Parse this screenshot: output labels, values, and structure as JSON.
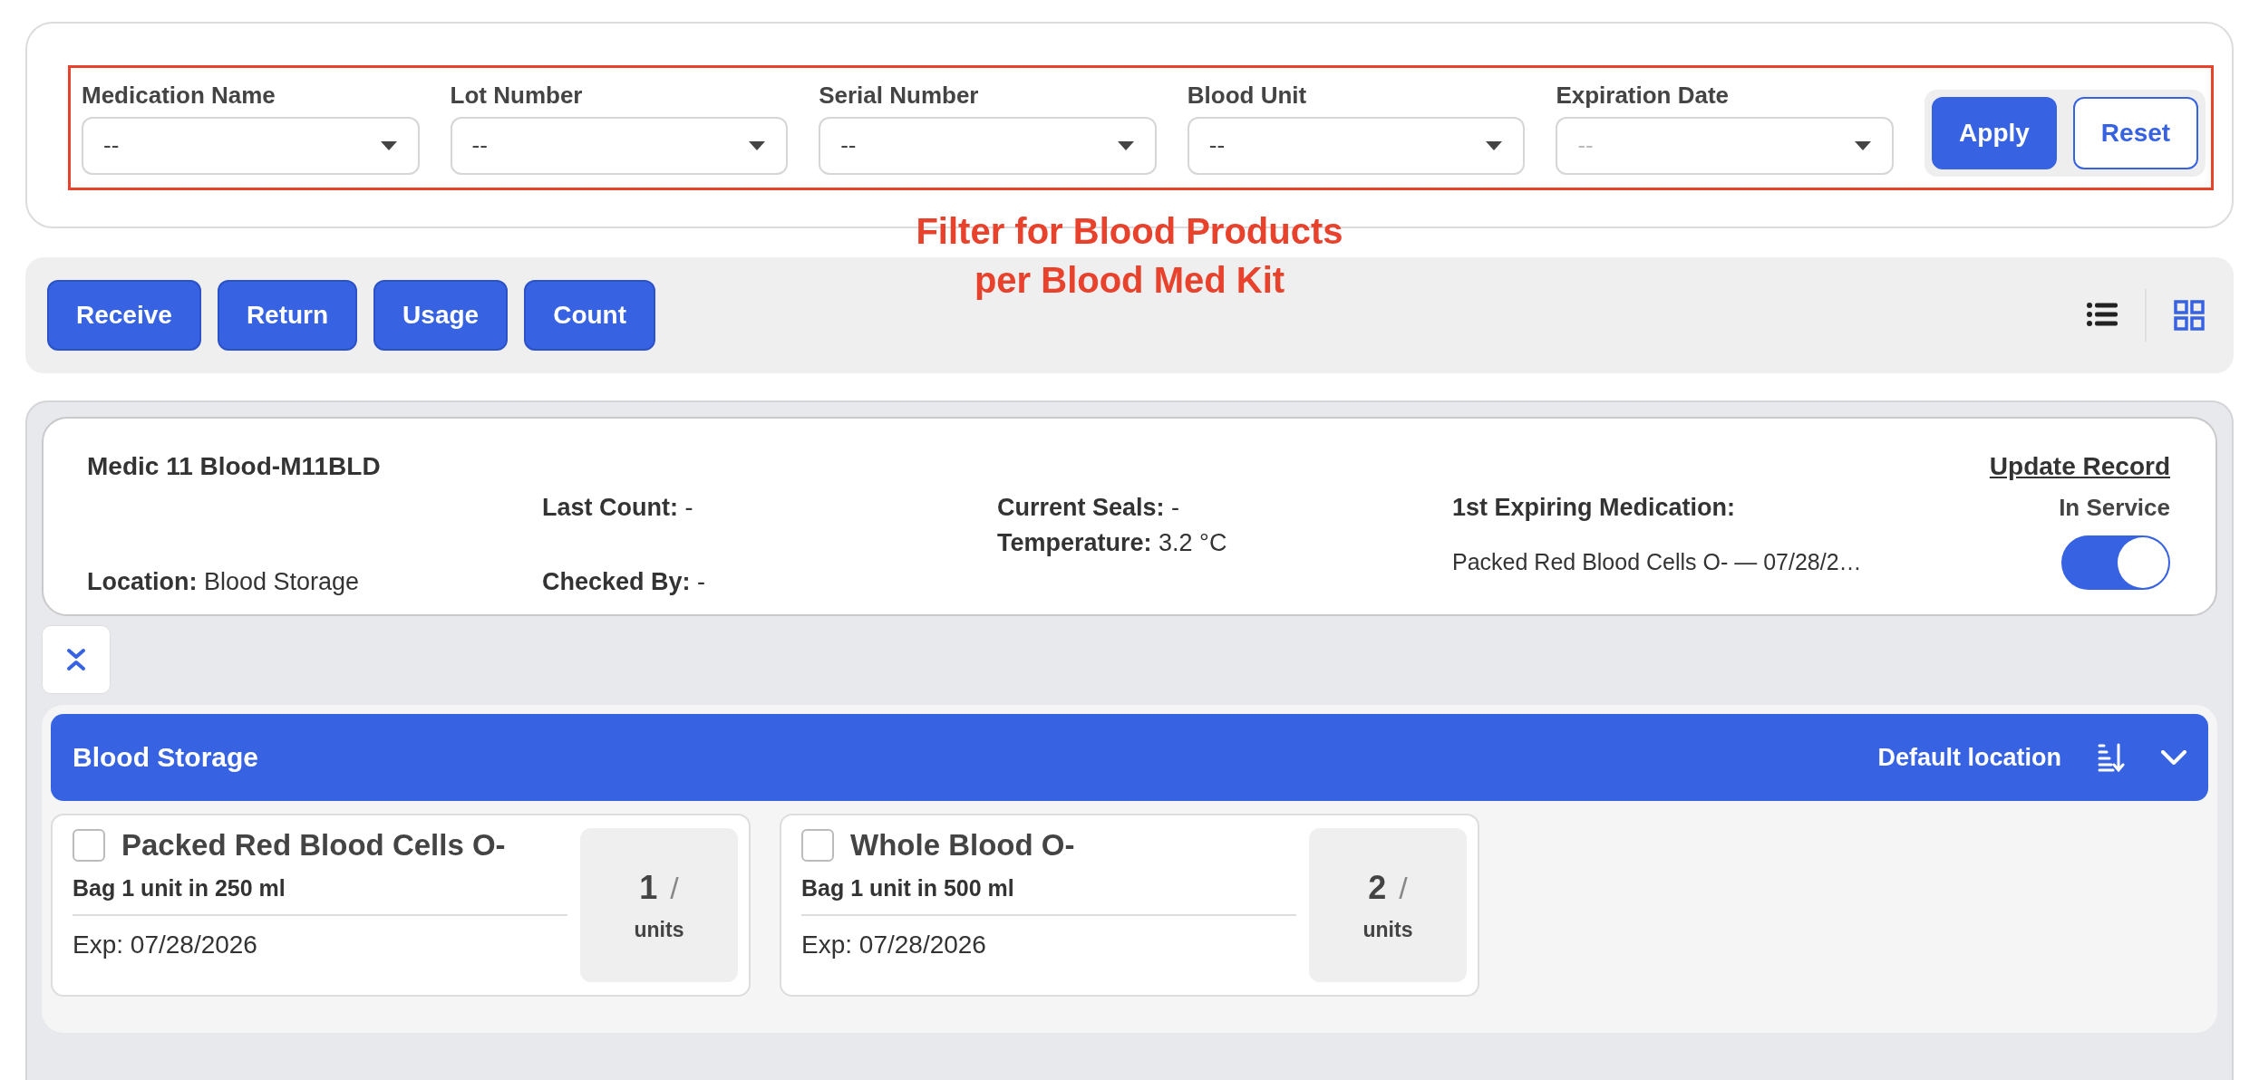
{
  "filters": {
    "fields": [
      {
        "label": "Medication Name",
        "value": "--"
      },
      {
        "label": "Lot Number",
        "value": "--"
      },
      {
        "label": "Serial Number",
        "value": "--"
      },
      {
        "label": "Blood Unit",
        "value": "--"
      },
      {
        "label": "Expiration Date",
        "placeholder": "--"
      }
    ],
    "buttons": [
      {
        "label": "Apply",
        "kind": "primary"
      },
      {
        "label": "Reset",
        "kind": "outline"
      }
    ]
  },
  "annotation": {
    "lines": [
      "Filter for Blood Products",
      "per Blood Med Kit"
    ]
  },
  "toolbar": {
    "actions": [
      "Receive",
      "Return",
      "Usage",
      "Count"
    ],
    "views": [
      {
        "kind": "list",
        "selected": false
      },
      {
        "kind": "grid",
        "selected": true
      }
    ]
  },
  "kit": {
    "title": "Medic 11 Blood-M11BLD",
    "update_link": "Update Record",
    "location": {
      "label": "Location:",
      "value": "Blood Storage"
    },
    "last_count": {
      "label": "Last Count:",
      "value": "-"
    },
    "checked_by": {
      "label": "Checked By:",
      "value": "-"
    },
    "current_seals": {
      "label": "Current Seals:",
      "value": "-"
    },
    "temperature": {
      "label": "Temperature:",
      "value": "3.2 °C"
    },
    "first_expiring": {
      "label": "1st Expiring Medication:",
      "value": "Packed Red Blood Cells O- — 07/28/2…"
    },
    "in_service": {
      "label": "In Service",
      "on": true
    }
  },
  "storage": {
    "name": "Blood Storage",
    "default_label": "Default location",
    "items": [
      {
        "name": "Packed Red Blood Cells O-",
        "package": "Bag 1 unit in 250 ml",
        "expiration": "Exp: 07/28/2026",
        "quantity": "1",
        "separator": "/",
        "unit": "units",
        "checked": false
      },
      {
        "name": "Whole Blood O-",
        "package": "Bag 1 unit in 500 ml",
        "expiration": "Exp: 07/28/2026",
        "quantity": "2",
        "separator": "/",
        "unit": "units",
        "checked": false
      }
    ]
  }
}
